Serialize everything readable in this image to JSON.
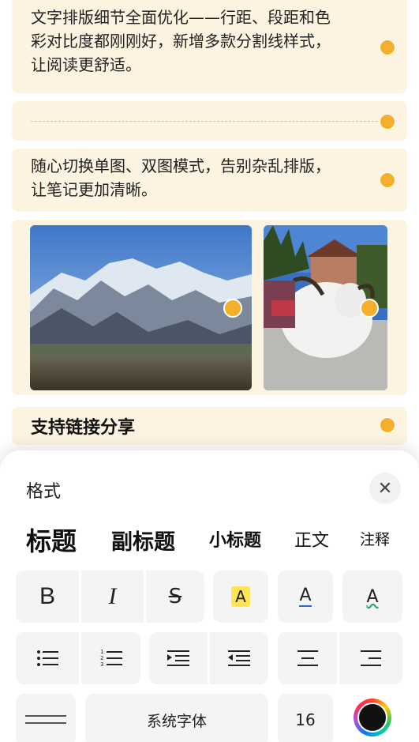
{
  "note": {
    "block1_lines": [
      "文字排版细节全面优化——行距、段距和色",
      "彩对比度都刚刚好，新增多款分割线样式，",
      "让阅读更舒适。"
    ],
    "block2_lines": [
      "随心切换单图、双图模式，告别杂乱排版，",
      "让笔记更加清晰。"
    ],
    "heading": "支持链接分享",
    "images": [
      {
        "name": "mountain-photo",
        "description": "snowy mountains"
      },
      {
        "name": "yak-photo",
        "description": "white yak with rider"
      }
    ]
  },
  "format_panel": {
    "title": "格式",
    "close_icon": "close-icon",
    "text_styles": [
      "标题",
      "副标题",
      "小标题",
      "正文",
      "注释"
    ],
    "style_buttons": [
      {
        "name": "bold",
        "glyph": "B"
      },
      {
        "name": "italic",
        "glyph": "I"
      },
      {
        "name": "strikethrough",
        "glyph": "S"
      },
      {
        "name": "highlight",
        "glyph": "A"
      },
      {
        "name": "underline",
        "glyph": "A"
      },
      {
        "name": "wavy-underline",
        "glyph": "A"
      }
    ],
    "font_name": "系统字体",
    "font_size": "16",
    "colors": {
      "accent_dot": "#f4b02a",
      "highlight": "#ffe45a",
      "underline": "#2f63d8",
      "wavy": "#27a86a"
    }
  }
}
